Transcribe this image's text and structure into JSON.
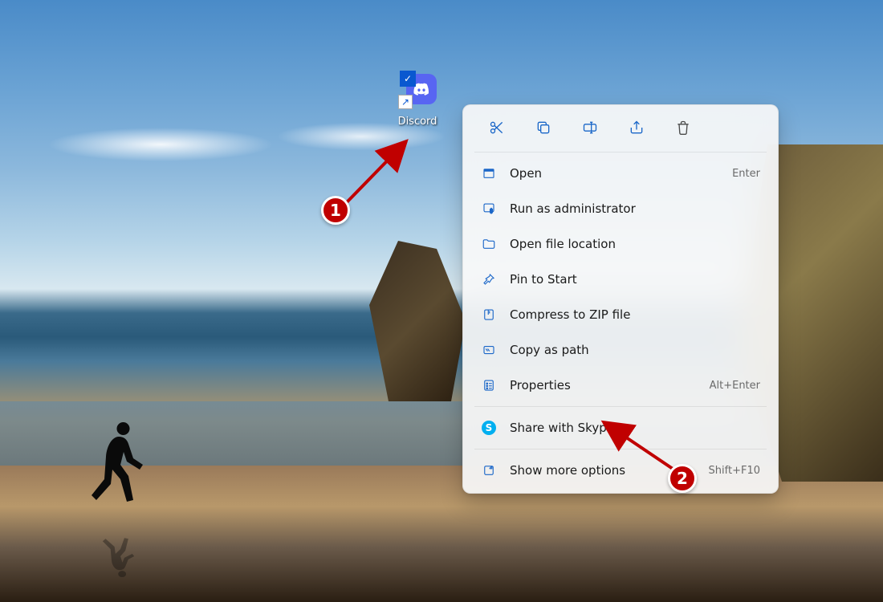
{
  "shortcut": {
    "label": "Discord",
    "app_name": "discord",
    "has_check_overlay": true,
    "has_shortcut_arrow": true
  },
  "context_menu": {
    "top_actions": [
      {
        "name": "cut",
        "icon": "scissors-icon"
      },
      {
        "name": "copy",
        "icon": "copy-icon"
      },
      {
        "name": "rename",
        "icon": "rename-icon"
      },
      {
        "name": "share",
        "icon": "share-icon"
      },
      {
        "name": "delete",
        "icon": "trash-icon"
      }
    ],
    "items": [
      {
        "id": "open",
        "label": "Open",
        "icon": "open-icon",
        "accel": "Enter"
      },
      {
        "id": "run-admin",
        "label": "Run as administrator",
        "icon": "shield-icon",
        "accel": ""
      },
      {
        "id": "open-loc",
        "label": "Open file location",
        "icon": "folder-icon",
        "accel": ""
      },
      {
        "id": "pin-start",
        "label": "Pin to Start",
        "icon": "pin-icon",
        "accel": ""
      },
      {
        "id": "compress",
        "label": "Compress to ZIP file",
        "icon": "zip-icon",
        "accel": ""
      },
      {
        "id": "copy-path",
        "label": "Copy as path",
        "icon": "path-icon",
        "accel": ""
      },
      {
        "id": "properties",
        "label": "Properties",
        "icon": "properties-icon",
        "accel": "Alt+Enter"
      }
    ],
    "extra": [
      {
        "id": "share-skype",
        "label": "Share with Skype",
        "icon": "skype-icon",
        "accel": ""
      }
    ],
    "footer": [
      {
        "id": "show-more",
        "label": "Show more options",
        "icon": "more-icon",
        "accel": "Shift+F10"
      }
    ]
  },
  "annotations": {
    "badge1": "1",
    "badge2": "2",
    "arrow_color": "#C00000"
  }
}
